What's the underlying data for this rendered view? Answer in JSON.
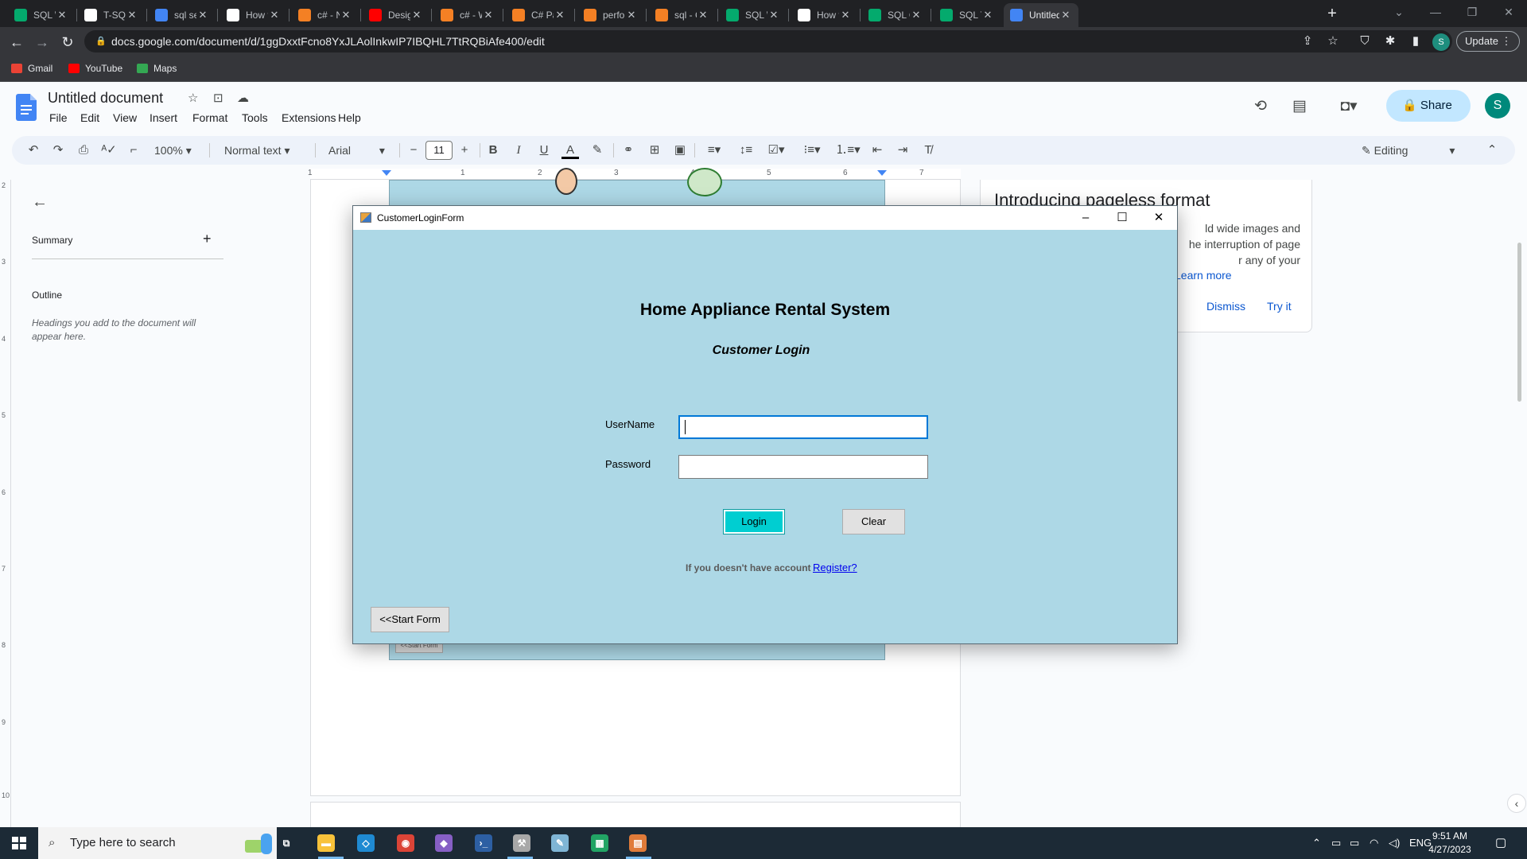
{
  "browser": {
    "tabs": [
      {
        "title": "SQL WH",
        "icon": "w3schools-icon",
        "color": "#04aa6d"
      },
      {
        "title": "T-SQL -",
        "icon": "page-icon",
        "color": "#ffffff"
      },
      {
        "title": "sql serve",
        "icon": "google-icon",
        "color": "#4285f4"
      },
      {
        "title": "How to",
        "icon": "page-icon",
        "color": "#ffffff"
      },
      {
        "title": "c# - Nor",
        "icon": "stackoverflow-icon",
        "color": "#f48024"
      },
      {
        "title": "Designin",
        "icon": "youtube-icon",
        "color": "#ff0000"
      },
      {
        "title": "c# - Win",
        "icon": "stackoverflow-icon",
        "color": "#f48024"
      },
      {
        "title": "C# Passi",
        "icon": "stackoverflow-icon",
        "color": "#f48024"
      },
      {
        "title": "perform",
        "icon": "stackoverflow-icon",
        "color": "#f48024"
      },
      {
        "title": "sql - Car",
        "icon": "stackoverflow-icon",
        "color": "#f48024"
      },
      {
        "title": "SQL Wi",
        "icon": "w3schools-icon",
        "color": "#04aa6d"
      },
      {
        "title": "How to",
        "icon": "page-icon",
        "color": "#ffffff"
      },
      {
        "title": "SQL CO",
        "icon": "w3schools-icon",
        "color": "#04aa6d"
      },
      {
        "title": "SQL Tryi",
        "icon": "w3schools-icon",
        "color": "#04aa6d"
      },
      {
        "title": "Untitled",
        "icon": "docs-icon",
        "color": "#4285f4",
        "active": true
      }
    ],
    "url": "docs.google.com/document/d/1ggDxxtFcno8YxJLAolInkwIP7IBQHL7TtRQBiAfe400/edit",
    "update_label": "Update",
    "profile_initial": "S",
    "bookmarks": [
      {
        "label": "Gmail",
        "color": "#ea4335"
      },
      {
        "label": "YouTube",
        "color": "#ff0000"
      },
      {
        "label": "Maps",
        "color": "#34a853"
      }
    ]
  },
  "docs": {
    "title": "Untitled document",
    "menu": [
      "File",
      "Edit",
      "View",
      "Insert",
      "Format",
      "Tools",
      "Extensions",
      "Help"
    ],
    "share_label": "Share",
    "avatar_initial": "S",
    "toolbar": {
      "zoom": "100%",
      "style": "Normal text",
      "font": "Arial",
      "font_size": "11",
      "editing_mode": "Editing"
    },
    "ruler_numbers": [
      "1",
      "1",
      "2",
      "3",
      "4",
      "5",
      "6",
      "7"
    ],
    "vruler_numbers": [
      "2",
      "3",
      "4",
      "5",
      "6",
      "7",
      "8",
      "9",
      "10"
    ],
    "outline_panel": {
      "summary": "Summary",
      "outline": "Outline",
      "hint": "Headings you add to the document will appear here."
    },
    "callout": {
      "title": "Introducing pageless format",
      "body_lines": [
        "ld wide images and",
        "he interruption of page",
        "r any of your"
      ],
      "learn_more": "Learn more",
      "dismiss": "Dismiss",
      "try_it": "Try it"
    },
    "embedded_image_button": "<<Start Form"
  },
  "winform": {
    "window_title": "CustomerLoginForm",
    "heading": "Home Appliance Rental System",
    "subheading": "Customer Login",
    "username_label": "UserName",
    "password_label": "Password",
    "login_label": "Login",
    "clear_label": "Clear",
    "no_account_text": "If you doesn't have account",
    "register_link": "Register?",
    "start_form_label": "<<Start Form",
    "colors": {
      "background": "#add8e6",
      "login_button": "#00ced1"
    }
  },
  "taskbar": {
    "search_placeholder": "Type here to search",
    "apps": [
      {
        "name": "task-view-icon",
        "color": "#1c2a36"
      },
      {
        "name": "file-explorer-icon",
        "color": "#f8c23a"
      },
      {
        "name": "vscode-icon",
        "color": "#1f8ad2"
      },
      {
        "name": "chrome-icon",
        "color": "#db4437"
      },
      {
        "name": "visual-studio-icon",
        "color": "#865fc5"
      },
      {
        "name": "powershell-icon",
        "color": "#2d5fa3"
      },
      {
        "name": "ssms-icon",
        "color": "#a8a8a8"
      },
      {
        "name": "notepad-icon",
        "color": "#7fb5d5"
      },
      {
        "name": "excel-like-icon",
        "color": "#22a565"
      },
      {
        "name": "winforms-app-icon",
        "color": "#e07b39"
      }
    ],
    "language": "ENG",
    "time": "9:51 AM",
    "date": "4/27/2023"
  }
}
